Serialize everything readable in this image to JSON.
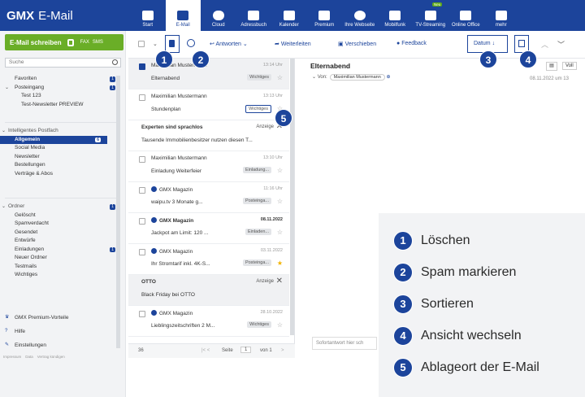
{
  "header": {
    "logo_brand": "GMX",
    "logo_product": "E-Mail",
    "nav": [
      "Start",
      "E-Mail",
      "Cloud",
      "Adressbuch",
      "Kalender",
      "Premium",
      "Ihre Webseite",
      "Mobilfunk",
      "TV-Streaming",
      "Online Office",
      "mehr"
    ],
    "nav_badge": "Neu"
  },
  "sidebar": {
    "compose": "E-Mail schreiben",
    "fax": "FAX",
    "sms": "SMS",
    "search_placeholder": "Suche",
    "favoriten": "Favoriten",
    "favoriten_count": "1",
    "posteingang": "Posteingang",
    "posteingang_count": "1",
    "test": "Test 123",
    "test_newsletter": "Test-Newsletter PREVIEW",
    "intelligent": "Intelligentes Postfach",
    "allgemein": "Allgemein",
    "allgemein_count": "6",
    "social": "Social Media",
    "newsletter": "Newsletter",
    "bestellungen": "Bestellungen",
    "vertraege": "Verträge & Abos",
    "ordner": "Ordner",
    "ordner_count": "1",
    "geloescht": "Gelöscht",
    "spam": "Spamverdacht",
    "gesendet": "Gesendet",
    "entwuerfe": "Entwürfe",
    "einladungen": "Einladungen",
    "einladungen_count": "1",
    "neuer_ordner": "Neuer Ordner",
    "testmails": "Testmails",
    "wichtiges": "Wichtiges",
    "premium": "GMX Premium-Vorteile",
    "hilfe": "Hilfe",
    "einstellungen": "Einstellungen",
    "foot": [
      "Impressum",
      "Data",
      "Vertrag kündigen"
    ]
  },
  "toolbar": {
    "antworten": "Antworten",
    "weiterleiten": "Weiterleiten",
    "verschieben": "Verschieben",
    "feedback": "Feedback",
    "datum": "Datum"
  },
  "mails": [
    {
      "sender": "Maximilian Mustermann",
      "date": "13:14 Uhr",
      "subject": "Elternabend",
      "tag": "Wichtiges"
    },
    {
      "sender": "Maximilian Mustermann",
      "date": "13:13 Uhr",
      "subject": "Stundenplan",
      "tag": "Wichtiges"
    },
    {
      "sender": "Experten sind sprachlos",
      "ad": "Anzeige",
      "subject": "Tausende Immobilienbesitzer nutzen diesen T..."
    },
    {
      "sender": "Maximilian Mustermann",
      "date": "13:10 Uhr",
      "subject": "Einladung Weiterfeier",
      "tag": "Einladung..."
    },
    {
      "sender": "GMX Magazin",
      "date": "11:16 Uhr",
      "subject": "waipu.tv 3 Monate g...",
      "tag": "Posteinga..."
    },
    {
      "sender": "GMX Magazin",
      "date": "08.11.2022",
      "subject": "Jackpot am Limit: 120 ...",
      "tag": "Einladen..."
    },
    {
      "sender": "GMX Magazin",
      "date": "03.11.2022",
      "subject": "Ihr Stromtarif inkl. 4K-S...",
      "tag": "Posteinga..."
    },
    {
      "sender": "OTTO",
      "ad": "Anzeige",
      "subject": "Black Friday bei OTTO"
    },
    {
      "sender": "GMX Magazin",
      "date": "28.10.2022",
      "subject": "Lieblingszeitschriften 2 M...",
      "tag": "Wichtiges"
    }
  ],
  "list_footer": {
    "seite": "Seite",
    "page": "1",
    "von": "von 1",
    "count": "36"
  },
  "preview": {
    "title": "Elternabend",
    "von": "Von:",
    "from": "Maximilian Mustermann",
    "date": "08.11.2022 um 13",
    "voll": "Voll",
    "reply_placeholder": "Sofortantwort hier sch"
  },
  "callouts": [
    "1",
    "2",
    "3",
    "4",
    "5"
  ],
  "legend": [
    {
      "num": "1",
      "label": "Löschen"
    },
    {
      "num": "2",
      "label": "Spam markieren"
    },
    {
      "num": "3",
      "label": "Sortieren"
    },
    {
      "num": "4",
      "label": "Ansicht wechseln"
    },
    {
      "num": "5",
      "label": "Ablageort der E-Mail"
    }
  ],
  "colors": {
    "brand": "#1c449b",
    "compose": "#6aae27",
    "legend_bg": "#f2f3f5"
  }
}
